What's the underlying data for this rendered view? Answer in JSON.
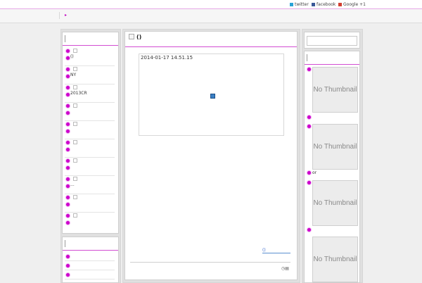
{
  "topbar": {
    "twitter": "twitter",
    "facebook": "facebook",
    "google": "Google +1"
  },
  "left_sidebar": {
    "widget1_items": [
      {
        "text": "()"
      },
      {
        "text": "NY"
      },
      {
        "text": "2013CR"
      },
      {
        "text": ""
      },
      {
        "text": ""
      },
      {
        "text": ""
      },
      {
        "text": ""
      },
      {
        "text": "..."
      },
      {
        "text": ""
      },
      {
        "text": ""
      }
    ]
  },
  "main": {
    "title": "()",
    "image_caption": "2014-01-17 14.51.15",
    "more_link": "()"
  },
  "right_sidebar": {
    "thumbnail_text": "No Thumbnail",
    "entry_text_2": "or"
  }
}
